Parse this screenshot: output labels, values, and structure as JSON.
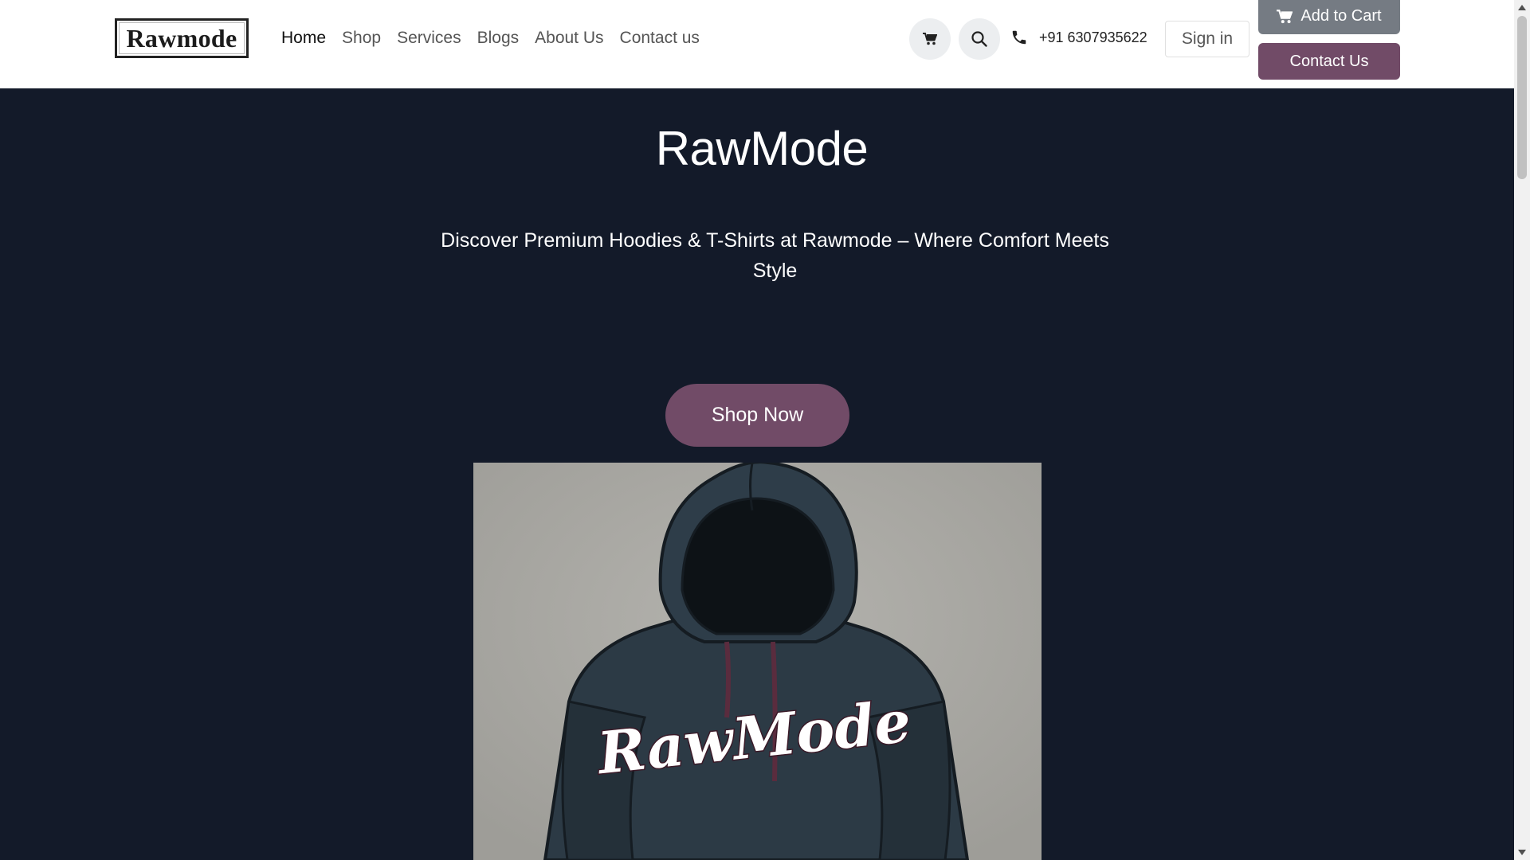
{
  "header": {
    "logo_text": "Rawmode",
    "nav": [
      {
        "label": "Home",
        "active": true
      },
      {
        "label": "Shop"
      },
      {
        "label": "Services"
      },
      {
        "label": "Blogs"
      },
      {
        "label": "About Us"
      },
      {
        "label": "Contact us"
      }
    ],
    "cart_icon": "cart-icon",
    "search_icon": "search-icon",
    "phone_icon": "phone-icon",
    "phone": "+91 6307935622",
    "sign_in": "Sign in",
    "add_to_cart": "Add to Cart",
    "contact_us": "Contact Us"
  },
  "hero": {
    "title": "RawMode",
    "subtitle": "Discover Premium Hoodies & T-Shirts at Rawmode – Where Comfort Meets Style",
    "cta": "Shop Now",
    "image_print": "RawMode"
  },
  "colors": {
    "brand": "#714b67",
    "hero_bg": "#131a29",
    "add_to_cart_bg": "#757b83"
  }
}
